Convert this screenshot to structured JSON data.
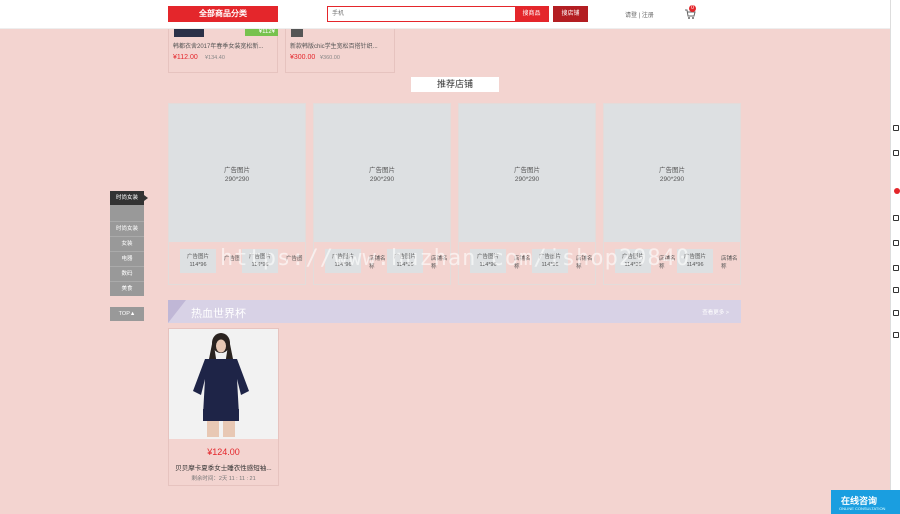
{
  "header": {
    "all_categories": "全部商品分类",
    "search_placeholder": "手机",
    "search_button": "搜商品",
    "store_button": "搜店铺",
    "login": "请登 | 注册",
    "cart_count": "0"
  },
  "top_products": [
    {
      "name": "韩都衣舍2017年春季女装宽松新...",
      "price": "¥112.00",
      "old_price": "¥134.40",
      "tag": "¥112¥"
    },
    {
      "name": "新款韩版chic学生宽松百搭针织...",
      "price": "¥300.00",
      "old_price": "¥360.00"
    }
  ],
  "recommend": {
    "title": "推荐店铺",
    "stores": [
      {
        "ad": "广告图片",
        "size": "290*290",
        "minis": [
          {
            "ad": "广告图片",
            "size": "114*96",
            "name": "广告图"
          },
          {
            "ad": "广告图片",
            "size": "114*96",
            "name": "广告图"
          }
        ]
      },
      {
        "ad": "广告图片",
        "size": "290*290",
        "minis": [
          {
            "ad": "广告图片",
            "size": "114*96",
            "name": "店铺名称"
          },
          {
            "ad": "广告图片",
            "size": "114*96",
            "name": "店铺名称"
          }
        ]
      },
      {
        "ad": "广告图片",
        "size": "290*290",
        "minis": [
          {
            "ad": "广告图片",
            "size": "114*96",
            "name": "店铺名称"
          },
          {
            "ad": "广告图片",
            "size": "114*96",
            "name": "店铺名称"
          }
        ]
      },
      {
        "ad": "广告图片",
        "size": "290*290",
        "minis": [
          {
            "ad": "广告图片",
            "size": "114*96",
            "name": "店铺名称"
          },
          {
            "ad": "广告图片",
            "size": "114*96",
            "name": "店铺名称"
          }
        ]
      }
    ]
  },
  "sidenav": {
    "head": "时尚女装",
    "items": [
      "时尚女装",
      "女装",
      "电器",
      "数码",
      "美食"
    ],
    "top": "TOP▲"
  },
  "worldcup": {
    "title": "热血世界杯",
    "more": "查看更多 >"
  },
  "product": {
    "price": "¥124.00",
    "name": "贝贝摩卡夏季女士睡衣性感短袖...",
    "time": "剩余时间：2天 11 : 11 : 21"
  },
  "watermark": "https://www.huzhan.com/ishop29840",
  "consult": {
    "big": "在线咨询",
    "small": "ONLINE CONSULTATION"
  }
}
